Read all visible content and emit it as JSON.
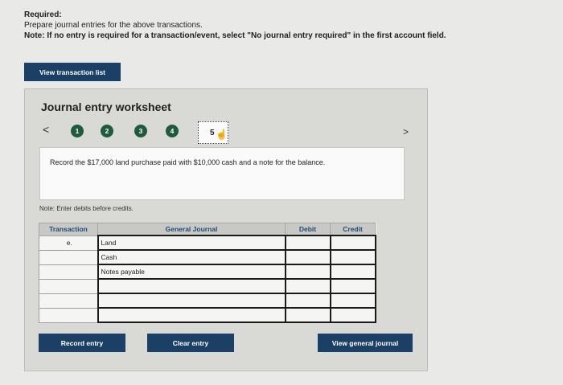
{
  "instructions": {
    "required": "Required:",
    "prepare": "Prepare journal entries for the above transactions.",
    "note": "Note: If no entry is required for a transaction/event, select \"No journal entry required\" in the first account field."
  },
  "view_transaction_list_label": "View transaction list",
  "worksheet": {
    "title": "Journal entry worksheet",
    "prev_glyph": "<",
    "next_glyph": ">",
    "steps": [
      "1",
      "2",
      "3",
      "4",
      "5"
    ],
    "active_step": "5",
    "description": "Record the $17,000 land purchase paid with $10,000 cash and a note for the balance.",
    "note_debits": "Note: Enter debits before credits.",
    "table": {
      "headers": [
        "Transaction",
        "General Journal",
        "Debit",
        "Credit"
      ],
      "rows": [
        {
          "transaction": "e.",
          "account": "Land",
          "debit": "",
          "credit": ""
        },
        {
          "transaction": "",
          "account": "Cash",
          "debit": "",
          "credit": ""
        },
        {
          "transaction": "",
          "account": "Notes payable",
          "debit": "",
          "credit": ""
        },
        {
          "transaction": "",
          "account": "",
          "debit": "",
          "credit": ""
        },
        {
          "transaction": "",
          "account": "",
          "debit": "",
          "credit": ""
        },
        {
          "transaction": "",
          "account": "",
          "debit": "",
          "credit": ""
        }
      ]
    },
    "buttons": {
      "record": "Record entry",
      "clear": "Clear entry",
      "view_journal": "View general journal"
    }
  },
  "icons": {
    "cursor": "hand-pointer-icon"
  },
  "colors": {
    "button_bg": "#1c3f66",
    "step_bg": "#1f5a3c",
    "header_text": "#1f4a7a"
  }
}
